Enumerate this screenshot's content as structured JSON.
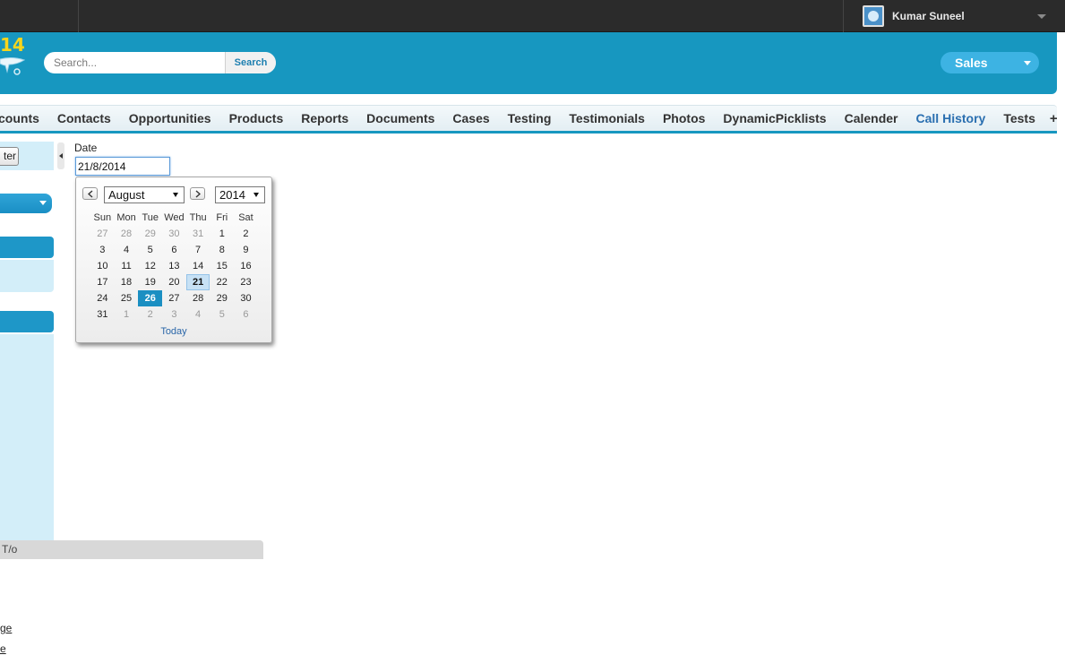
{
  "topbar": {
    "user_name": "Kumar Suneel"
  },
  "header": {
    "logo_text": "14",
    "search": {
      "placeholder": "Search...",
      "button_label": "Search"
    },
    "app_switcher": "Sales"
  },
  "tabs": [
    {
      "label": "counts"
    },
    {
      "label": "Contacts"
    },
    {
      "label": "Opportunities"
    },
    {
      "label": "Products"
    },
    {
      "label": "Reports"
    },
    {
      "label": "Documents"
    },
    {
      "label": "Cases"
    },
    {
      "label": "Testing"
    },
    {
      "label": "Testimonials"
    },
    {
      "label": "Photos"
    },
    {
      "label": "DynamicPicklists"
    },
    {
      "label": "Calender"
    },
    {
      "label": "Call History",
      "active": true
    },
    {
      "label": "Tests"
    }
  ],
  "tab_plus": "+",
  "sidebar": {
    "filter_button": "ter",
    "link1": "ge",
    "link2": "e"
  },
  "bottombar": {
    "text": "T/o"
  },
  "date_field": {
    "label": "Date",
    "value": "21/8/2014"
  },
  "calendar": {
    "month": "August",
    "year": "2014",
    "weekdays": [
      "Sun",
      "Mon",
      "Tue",
      "Wed",
      "Thu",
      "Fri",
      "Sat"
    ],
    "weeks": [
      [
        "27",
        "28",
        "29",
        "30",
        "31",
        "1",
        "2"
      ],
      [
        "3",
        "4",
        "5",
        "6",
        "7",
        "8",
        "9"
      ],
      [
        "10",
        "11",
        "12",
        "13",
        "14",
        "15",
        "16"
      ],
      [
        "17",
        "18",
        "19",
        "20",
        "21",
        "22",
        "23"
      ],
      [
        "24",
        "25",
        "26",
        "27",
        "28",
        "29",
        "30"
      ],
      [
        "31",
        "1",
        "2",
        "3",
        "4",
        "5",
        "6"
      ]
    ],
    "selected_day": "21",
    "today_day": "26",
    "today_label": "Today"
  }
}
